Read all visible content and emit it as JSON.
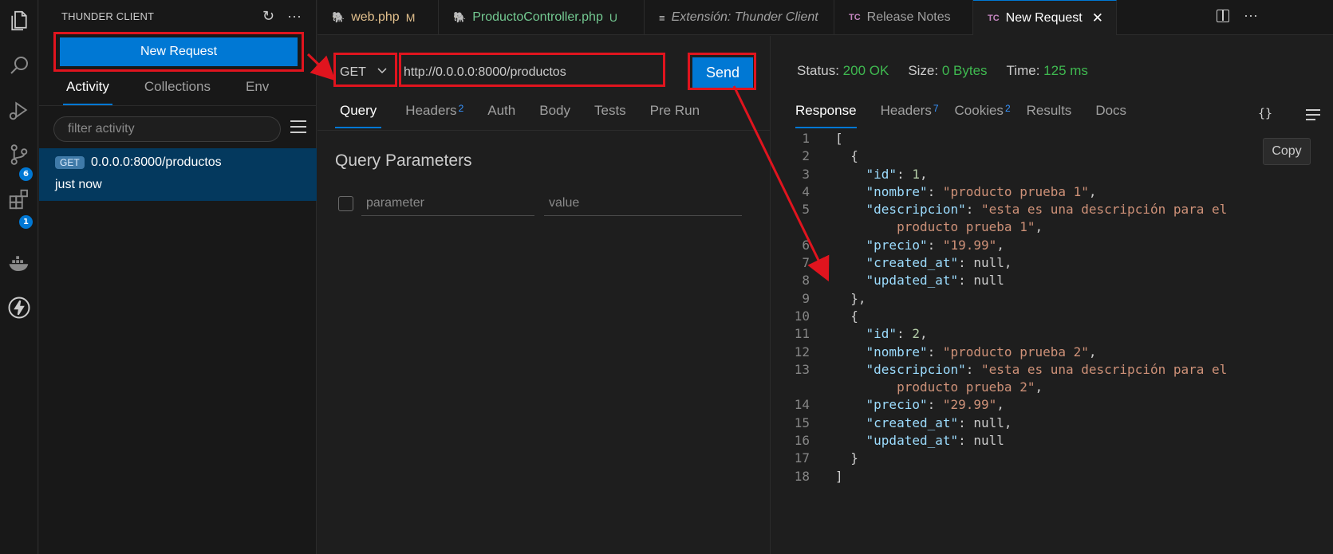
{
  "sidebar": {
    "title": "THUNDER CLIENT",
    "refresh_icon": "↻",
    "more_icon": "···",
    "new_request_label": "New Request",
    "tabs": [
      {
        "label": "Activity"
      },
      {
        "label": "Collections"
      },
      {
        "label": "Env"
      }
    ],
    "filter_placeholder": "filter activity",
    "activity": {
      "method": "GET",
      "url": "0.0.0.0:8000/productos",
      "time": "just now"
    }
  },
  "activity_bar": {
    "source_control_badge": "6",
    "extensions_badge": "1"
  },
  "editor_tabs": [
    {
      "icon": "🐘",
      "label": "web.php",
      "status": "M"
    },
    {
      "icon": "🐘",
      "label": "ProductoController.php",
      "status": "U"
    },
    {
      "icon": "≡",
      "label": "Extensión: Thunder Client"
    },
    {
      "icon": "TC",
      "label": "Release Notes"
    },
    {
      "icon": "TC",
      "label": "New Request",
      "close": "✕"
    }
  ],
  "request": {
    "method": "GET",
    "url": "http://0.0.0.0:8000/productos",
    "send_label": "Send",
    "tabs": [
      {
        "label": "Query"
      },
      {
        "label": "Headers",
        "count": "2"
      },
      {
        "label": "Auth"
      },
      {
        "label": "Body"
      },
      {
        "label": "Tests"
      },
      {
        "label": "Pre Run"
      }
    ],
    "query_title": "Query Parameters",
    "param_placeholder": "parameter",
    "value_placeholder": "value"
  },
  "response": {
    "status_label": "Status:",
    "status_value": "200 OK",
    "size_label": "Size:",
    "size_value": "0 Bytes",
    "time_label": "Time:",
    "time_value": "125 ms",
    "tabs": [
      {
        "label": "Response"
      },
      {
        "label": "Headers",
        "count": "7"
      },
      {
        "label": "Cookies",
        "count": "2"
      },
      {
        "label": "Results"
      },
      {
        "label": "Docs"
      }
    ],
    "braces_icon": "{}",
    "copy_label": "Copy",
    "lines": [
      {
        "n": "1",
        "t": "["
      },
      {
        "n": "2",
        "t": "  {"
      },
      {
        "n": "3",
        "t": "    \"id\": 1,"
      },
      {
        "n": "4",
        "t": "    \"nombre\": \"producto prueba 1\","
      },
      {
        "n": "5",
        "t": "    \"descripcion\": \"esta es una descripción para el"
      },
      {
        "n": "",
        "t": "        producto prueba 1\","
      },
      {
        "n": "6",
        "t": "    \"precio\": \"19.99\","
      },
      {
        "n": "7",
        "t": "    \"created_at\": null,"
      },
      {
        "n": "8",
        "t": "    \"updated_at\": null"
      },
      {
        "n": "9",
        "t": "  },"
      },
      {
        "n": "10",
        "t": "  {"
      },
      {
        "n": "11",
        "t": "    \"id\": 2,"
      },
      {
        "n": "12",
        "t": "    \"nombre\": \"producto prueba 2\","
      },
      {
        "n": "13",
        "t": "    \"descripcion\": \"esta es una descripción para el"
      },
      {
        "n": "",
        "t": "        producto prueba 2\","
      },
      {
        "n": "14",
        "t": "    \"precio\": \"29.99\","
      },
      {
        "n": "15",
        "t": "    \"created_at\": null,"
      },
      {
        "n": "16",
        "t": "    \"updated_at\": null"
      },
      {
        "n": "17",
        "t": "  }"
      },
      {
        "n": "18",
        "t": "]"
      }
    ]
  },
  "colors": {
    "accent": "#0078d4",
    "annotation": "#e0141e",
    "success": "#3fb950"
  }
}
